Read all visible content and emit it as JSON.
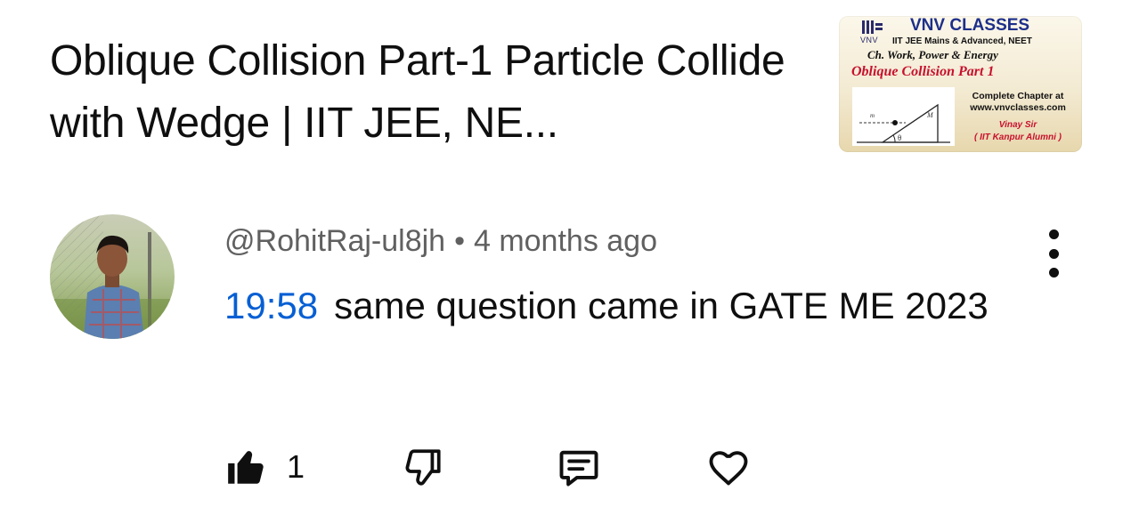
{
  "video": {
    "title": "Oblique Collision Part-1 Particle Collide with Wedge | IIT JEE, NE...",
    "thumbnail": {
      "logo_text": "VNV",
      "brand": "VNV CLASSES",
      "exams": "IIT JEE Mains & Advanced, NEET",
      "chapter": "Ch. Work, Power & Energy",
      "topic": "Oblique Collision Part 1",
      "promo_line1": "Complete Chapter at",
      "promo_line2": "www.vnvclasses.com",
      "author": "Vinay Sir",
      "author_note": "( IIT Kanpur Alumni )",
      "diagram_label_m": "m",
      "diagram_label_M": "M",
      "diagram_label_theta": "θ"
    }
  },
  "comment": {
    "author_handle": "@RohitRaj-ul8jh",
    "separator": "•",
    "time_ago": "4 months ago",
    "timestamp": "19:58",
    "text": "same question came in GATE ME 2023",
    "like_count": "1"
  },
  "icons": {
    "like": "thumbs-up-filled-icon",
    "dislike": "thumbs-down-outline-icon",
    "reply": "comment-reply-icon",
    "heart": "heart-outline-icon",
    "more": "vertical-ellipsis-icon"
  },
  "colors": {
    "link": "#065fd4",
    "meta_text": "#606060",
    "text": "#0f0f0f",
    "background": "#ffffff"
  }
}
